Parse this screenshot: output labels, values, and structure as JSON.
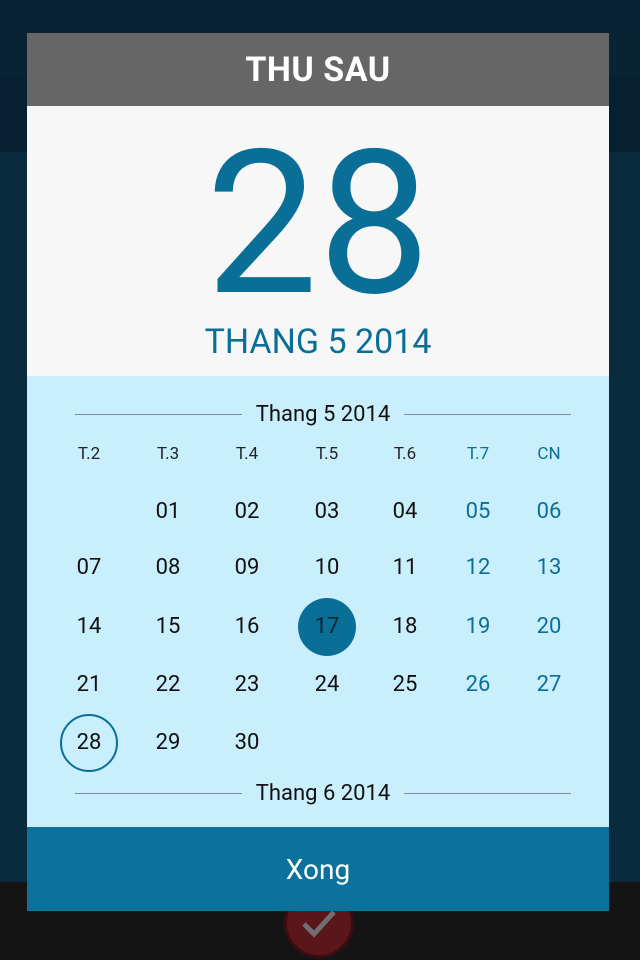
{
  "dialog": {
    "header_weekday": "THU SAU",
    "big_day": "28",
    "month_year_label": "THANG 5 2014",
    "done_label": "Xong"
  },
  "calendar": {
    "current_month_label": "Thang 5 2014",
    "next_month_label": "Thang 6 2014",
    "weekday_labels": [
      "T.2",
      "T.3",
      "T.4",
      "T.5",
      "T.6",
      "T.7",
      "CN"
    ],
    "weeks": [
      [
        "",
        "01",
        "02",
        "03",
        "04",
        "05",
        "06"
      ],
      [
        "07",
        "08",
        "09",
        "10",
        "11",
        "12",
        "13"
      ],
      [
        "14",
        "15",
        "16",
        "17",
        "18",
        "19",
        "20"
      ],
      [
        "21",
        "22",
        "23",
        "24",
        "25",
        "26",
        "27"
      ],
      [
        "28",
        "29",
        "30",
        "",
        "",
        "",
        ""
      ]
    ],
    "selected_day": "17",
    "today_day": "28"
  },
  "colors": {
    "accent": "#0a6f97",
    "header_gray": "#666666",
    "calendar_bg": "#c9eefc",
    "done_bar": "#0a729c"
  },
  "icons": {
    "background_back": "back-arrow-icon",
    "background_check": "check-icon"
  }
}
